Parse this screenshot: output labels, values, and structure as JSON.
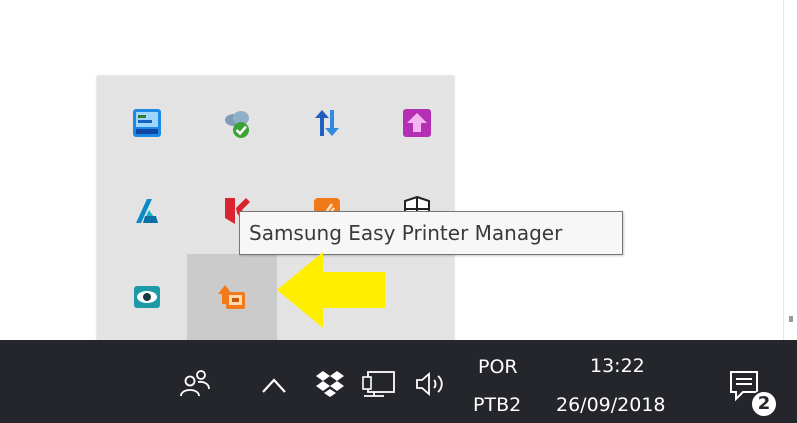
{
  "tray_overflow": {
    "icons": [
      {
        "icon": "control-panel-icon"
      },
      {
        "icon": "cloud-sync-check-icon"
      },
      {
        "icon": "sync-arrows-icon"
      },
      {
        "icon": "purple-upload-icon"
      },
      {
        "icon": "autodesk-icon"
      },
      {
        "icon": "kaspersky-icon"
      },
      {
        "icon": "orange-app-icon"
      },
      {
        "icon": "windows-security-shield-icon"
      },
      {
        "icon": "eye-monitor-icon"
      },
      {
        "icon": "samsung-easy-printer-manager-icon"
      }
    ],
    "highlighted_index": 9
  },
  "tooltip": {
    "text": "Samsung Easy Printer Manager"
  },
  "annotation": {
    "arrow_color": "#ffee00"
  },
  "taskbar": {
    "background": "#24262b",
    "icons": [
      "people-icon",
      "chevron-up-icon",
      "dropbox-icon",
      "network-icon",
      "volume-icon"
    ],
    "language_line1": "POR",
    "language_line2": "PTB2",
    "time": "13:22",
    "date": "26/09/2018",
    "notification_icon": "action-center-icon",
    "notification_count": "2"
  }
}
